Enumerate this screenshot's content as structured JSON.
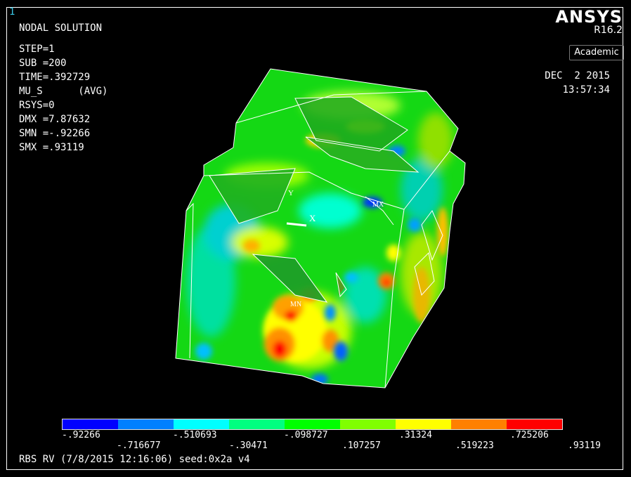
{
  "window_number": "1",
  "solution_title": "NODAL SOLUTION",
  "params": [
    "STEP=1",
    "SUB =200",
    "TIME=.392729",
    "MU_S      (AVG)",
    "RSYS=0",
    "DMX =7.87632",
    "SMN =-.92266",
    "SMX =.93119"
  ],
  "brand": {
    "name": "ANSYS",
    "release": "R16.2",
    "license": "Academic"
  },
  "date": "DEC  2 2015",
  "time": "13:57:34",
  "model_labels": {
    "x": "X",
    "y": "Y",
    "max": "MX",
    "min": "MN"
  },
  "legend": {
    "colors": [
      "#0000ff",
      "#0080ff",
      "#00ffff",
      "#00ff80",
      "#00ff00",
      "#80ff00",
      "#ffff00",
      "#ff8000",
      "#ff0000"
    ],
    "top_labels": [
      "-.92266",
      "-.510693",
      "-.098727",
      ".31324",
      ".725206"
    ],
    "bottom_labels": [
      "-.716677",
      "-.30471",
      ".107257",
      ".519223",
      ".93119"
    ]
  },
  "footer": "RBS RV (7/8/2015 12:16:06) seed:0x2a v4"
}
